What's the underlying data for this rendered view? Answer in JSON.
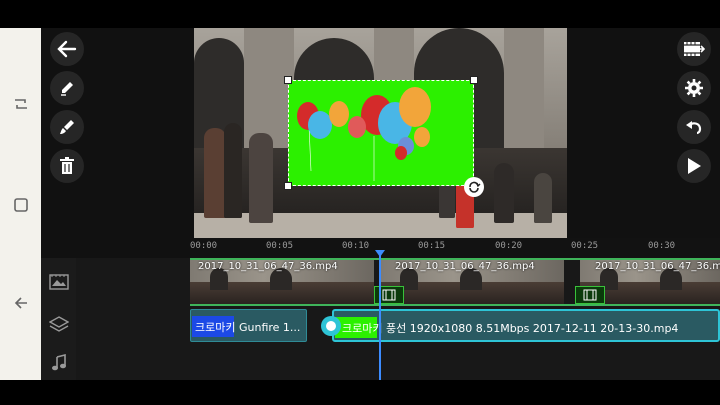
{
  "timeline": {
    "ticks": [
      "00:00",
      "00:05",
      "00:10",
      "00:15",
      "00:20",
      "00:25",
      "00:30"
    ],
    "video_clip_label": "2017_10_31_06_47_36.mp4",
    "layer1_label": "크로마키 Gunfire 1...",
    "layer2_label": "크로마키 풍선 1920x1080 8.51Mbps 2017-12-11 20-13-30.mp4",
    "playhead_position_seconds": 11.7
  },
  "left_tools": [
    "back-arrow",
    "pencil",
    "brush",
    "trash"
  ],
  "right_tools": [
    "film-export",
    "gear",
    "undo",
    "play"
  ],
  "track_icons": [
    "video-track",
    "layer-track",
    "audio-track"
  ],
  "navbar_icons": [
    "recent-apps",
    "home",
    "back"
  ],
  "colors": {
    "accent_teal": "#2ec4d6",
    "chroma_green": "#2cf000",
    "playhead_blue": "#3c8cff",
    "video_border": "#3fb45a"
  }
}
